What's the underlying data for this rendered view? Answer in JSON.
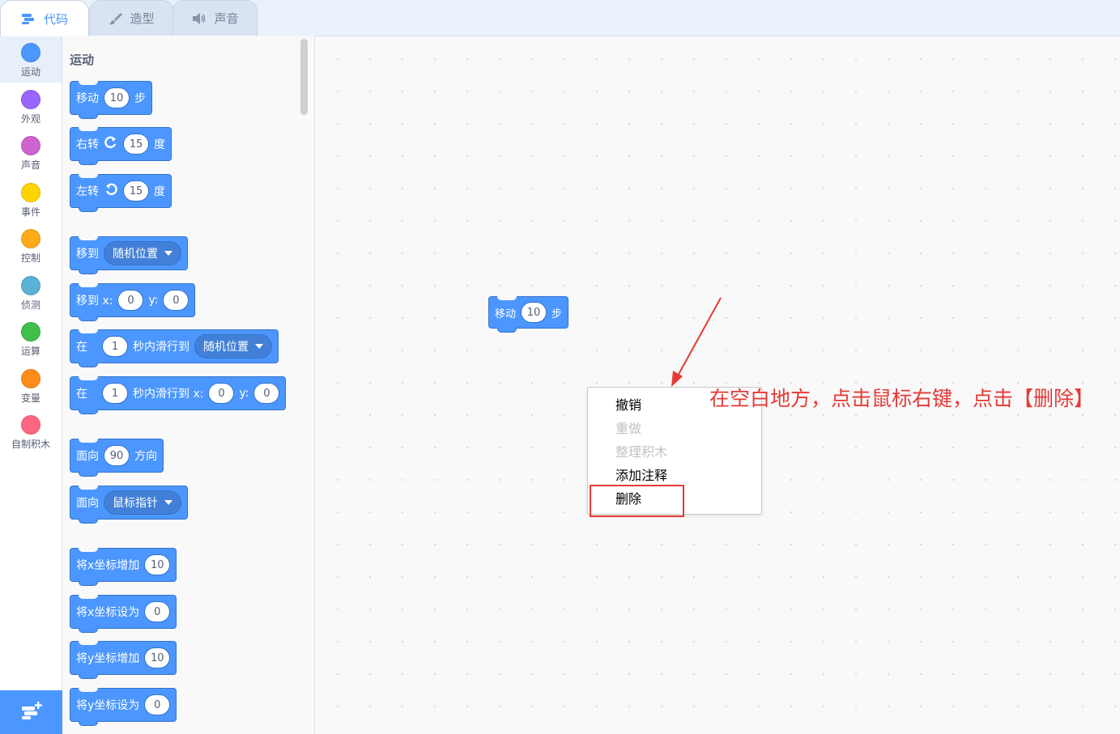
{
  "tabs": [
    {
      "label": "代码",
      "icon": "code-icon",
      "active": true
    },
    {
      "label": "造型",
      "icon": "brush-icon",
      "active": false
    },
    {
      "label": "声音",
      "icon": "speaker-icon",
      "active": false
    }
  ],
  "categories": [
    {
      "label": "运动",
      "color": "#4c97ff"
    },
    {
      "label": "外观",
      "color": "#9966ff"
    },
    {
      "label": "声音",
      "color": "#cf63cf"
    },
    {
      "label": "事件",
      "color": "#ffd500"
    },
    {
      "label": "控制",
      "color": "#ffab19"
    },
    {
      "label": "侦测",
      "color": "#5cb1d6"
    },
    {
      "label": "运算",
      "color": "#40bf4a"
    },
    {
      "label": "变量",
      "color": "#ff8c1a"
    },
    {
      "label": "自制积木",
      "color": "#ff6680"
    }
  ],
  "palette": {
    "title": "运动",
    "blocks": {
      "move": {
        "text": "移动",
        "steps": "10",
        "suffix": "步"
      },
      "turn_right": {
        "text": "右转",
        "degrees": "15",
        "suffix": "度"
      },
      "turn_left": {
        "text": "左转",
        "degrees": "15",
        "suffix": "度"
      },
      "goto": {
        "text": "移到",
        "target": "随机位置"
      },
      "goto_xy": {
        "text": "移到 x:",
        "x": "0",
        "y_label": "y:",
        "y": "0"
      },
      "glide": {
        "prefix": "在",
        "secs": "1",
        "text": "秒内滑行到",
        "target": "随机位置"
      },
      "glide_xy": {
        "prefix": "在",
        "secs": "1",
        "text": "秒内滑行到 x:",
        "x": "0",
        "y_label": "y:",
        "y": "0"
      },
      "point_dir": {
        "text": "面向",
        "dir": "90",
        "suffix": "方向"
      },
      "point_towards": {
        "text": "面向",
        "target": "鼠标指针"
      },
      "change_x": {
        "text": "将x坐标增加",
        "value": "10"
      },
      "set_x": {
        "text": "将x坐标设为",
        "value": "0"
      },
      "change_y": {
        "text": "将y坐标增加",
        "value": "10"
      },
      "set_y": {
        "text": "将y坐标设为",
        "value": "0"
      }
    }
  },
  "workspace": {
    "block": {
      "text": "移动",
      "steps": "10",
      "suffix": "步"
    }
  },
  "context_menu": {
    "items": [
      {
        "label": "撤销",
        "enabled": true
      },
      {
        "label": "重做",
        "enabled": false
      },
      {
        "label": "整理积木",
        "enabled": false
      },
      {
        "label": "添加注释",
        "enabled": true
      },
      {
        "label": "删除",
        "enabled": true
      }
    ]
  },
  "annotation": {
    "text": "在空白地方，点击鼠标右键，点击【删除】",
    "color": "#e53935"
  },
  "colors": {
    "accent": "#4c97ff",
    "block_border": "#3373cc",
    "highlight": "#e53935"
  }
}
